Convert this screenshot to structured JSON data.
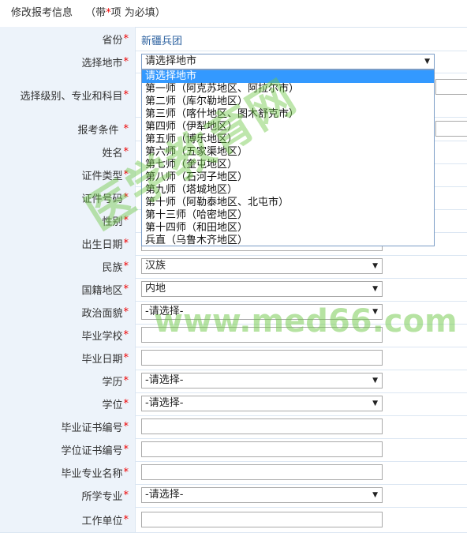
{
  "header": {
    "title": "修改报考信息",
    "note": "（带",
    "star": "*",
    "note2": "项  为必填）"
  },
  "fields": {
    "province": {
      "label": "省份",
      "value": "新疆兵团"
    },
    "city": {
      "label": "选择地市"
    },
    "level": {
      "label": "选择级别、专业和科目"
    },
    "condition": {
      "label": "报考条件"
    },
    "name": {
      "label": "姓名"
    },
    "idtype": {
      "label": "证件类型"
    },
    "idnum": {
      "label": "证件号码"
    },
    "gender": {
      "label": "性别"
    },
    "birth": {
      "label": "出生日期"
    },
    "nation": {
      "label": "民族",
      "value": "汉族"
    },
    "region": {
      "label": "国籍地区",
      "value": "内地"
    },
    "political": {
      "label": "政治面貌",
      "value": "-请选择-"
    },
    "school": {
      "label": "毕业学校"
    },
    "gradDate": {
      "label": "毕业日期"
    },
    "education": {
      "label": "学历",
      "value": "-请选择-"
    },
    "degree": {
      "label": "学位",
      "value": "-请选择-"
    },
    "diplomaNo": {
      "label": "毕业证书编号"
    },
    "degreeNo": {
      "label": "学位证书编号"
    },
    "major": {
      "label": "毕业专业名称"
    },
    "studyMajor": {
      "label": "所学专业",
      "value": "-请选择-"
    },
    "work": {
      "label": "工作单位"
    }
  },
  "required_mark": "*",
  "city_dropdown": {
    "selected": "请选择地市",
    "options": [
      "请选择地市",
      "第一师（阿克苏地区、阿拉尔市）",
      "第二师（库尔勒地区）",
      "第三师（喀什地区、图木舒克市）",
      "第四师（伊犁地区）",
      "第五师（博乐地区）",
      "第六师（五家渠地区）",
      "第七师（奎屯地区）",
      "第八师（石河子地区）",
      "第九师（塔城地区）",
      "第十师（阿勒泰地区、北屯市）",
      "第十三师（哈密地区）",
      "第十四师（和田地区）",
      "兵直（乌鲁木齐地区）"
    ]
  },
  "watermark": {
    "text1": "医学教育网",
    "text2": "www.med66.com"
  },
  "icons": {
    "dropdown_arrow": "▼"
  },
  "colors": {
    "label_bg": "#edf3fa",
    "required": "#e00000",
    "selected_option": "#3399ff",
    "watermark": "#6ec846"
  }
}
